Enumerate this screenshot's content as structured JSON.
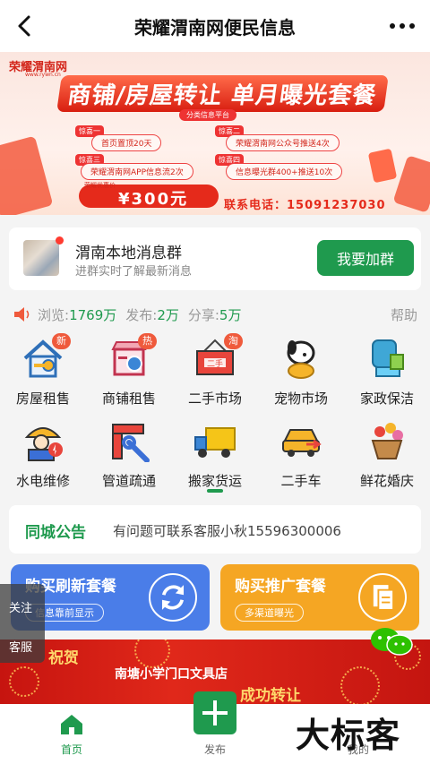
{
  "header": {
    "title": "荣耀渭南网便民信息"
  },
  "banner": {
    "logo": "荣耀渭南网",
    "logo_sub": "www.rywn.cn",
    "headline": "商铺/房屋转让 单月曝光套餐",
    "sub": "分类信息平台",
    "tags": [
      "惊喜一",
      "惊喜二",
      "惊喜三",
      "惊喜四"
    ],
    "items": [
      "首页置顶20天",
      "荣耀渭南网公众号推送4次",
      "荣耀渭南网APP信息流2次",
      "信息曝光群400+推送10次"
    ],
    "price_label": "荣耀优惠价",
    "price": "¥300元",
    "phone": "联系电话：15091237030"
  },
  "group": {
    "title": "渭南本地消息群",
    "subtitle": "进群实时了解最新消息",
    "join_label": "我要加群"
  },
  "stats": {
    "views_label": "浏览:",
    "views": "1769万",
    "posts_label": "发布:",
    "posts": "2万",
    "shares_label": "分享:",
    "shares": "5万",
    "help": "帮助"
  },
  "categories": [
    {
      "label": "房屋租售",
      "badge": "新",
      "icon": "house-key-icon"
    },
    {
      "label": "商铺租售",
      "badge": "热",
      "icon": "shop-icon"
    },
    {
      "label": "二手市场",
      "badge": "淘",
      "icon": "secondhand-sign-icon"
    },
    {
      "label": "宠物市场",
      "badge": "",
      "icon": "pet-dog-icon"
    },
    {
      "label": "家政保洁",
      "badge": "",
      "icon": "glove-cleaning-icon"
    },
    {
      "label": "水电维修",
      "badge": "",
      "icon": "worker-electric-icon"
    },
    {
      "label": "管道疏通",
      "badge": "",
      "icon": "pipe-wrench-icon"
    },
    {
      "label": "搬家货运",
      "badge": "",
      "icon": "truck-icon"
    },
    {
      "label": "二手车",
      "badge": "",
      "icon": "car-icon"
    },
    {
      "label": "鲜花婚庆",
      "badge": "",
      "icon": "flower-basket-icon"
    }
  ],
  "notice": {
    "title": "同城公告",
    "text": "有问题可联系客服小秋15596300006"
  },
  "promos": [
    {
      "title": "购买刷新套餐",
      "sub": "信息靠前显示",
      "color": "#4a7de8",
      "icon": "refresh-icon"
    },
    {
      "title": "购买推广套餐",
      "sub": "多渠道曝光",
      "color": "#f5a623",
      "icon": "document-icon"
    }
  ],
  "side": {
    "follow": "关注",
    "service": "客服"
  },
  "red_banner": {
    "congrats": "祝贺",
    "shop": "南塘小学门口文具店",
    "done": "成功转让"
  },
  "tabbar": {
    "home": "首页",
    "publish": "发布",
    "mine": "我的"
  },
  "watermark": "大标客",
  "colors": {
    "brand_green": "#1f9a4e",
    "promo_blue": "#4a7de8",
    "promo_orange": "#f5a623",
    "banner_red": "#e52a1b"
  }
}
